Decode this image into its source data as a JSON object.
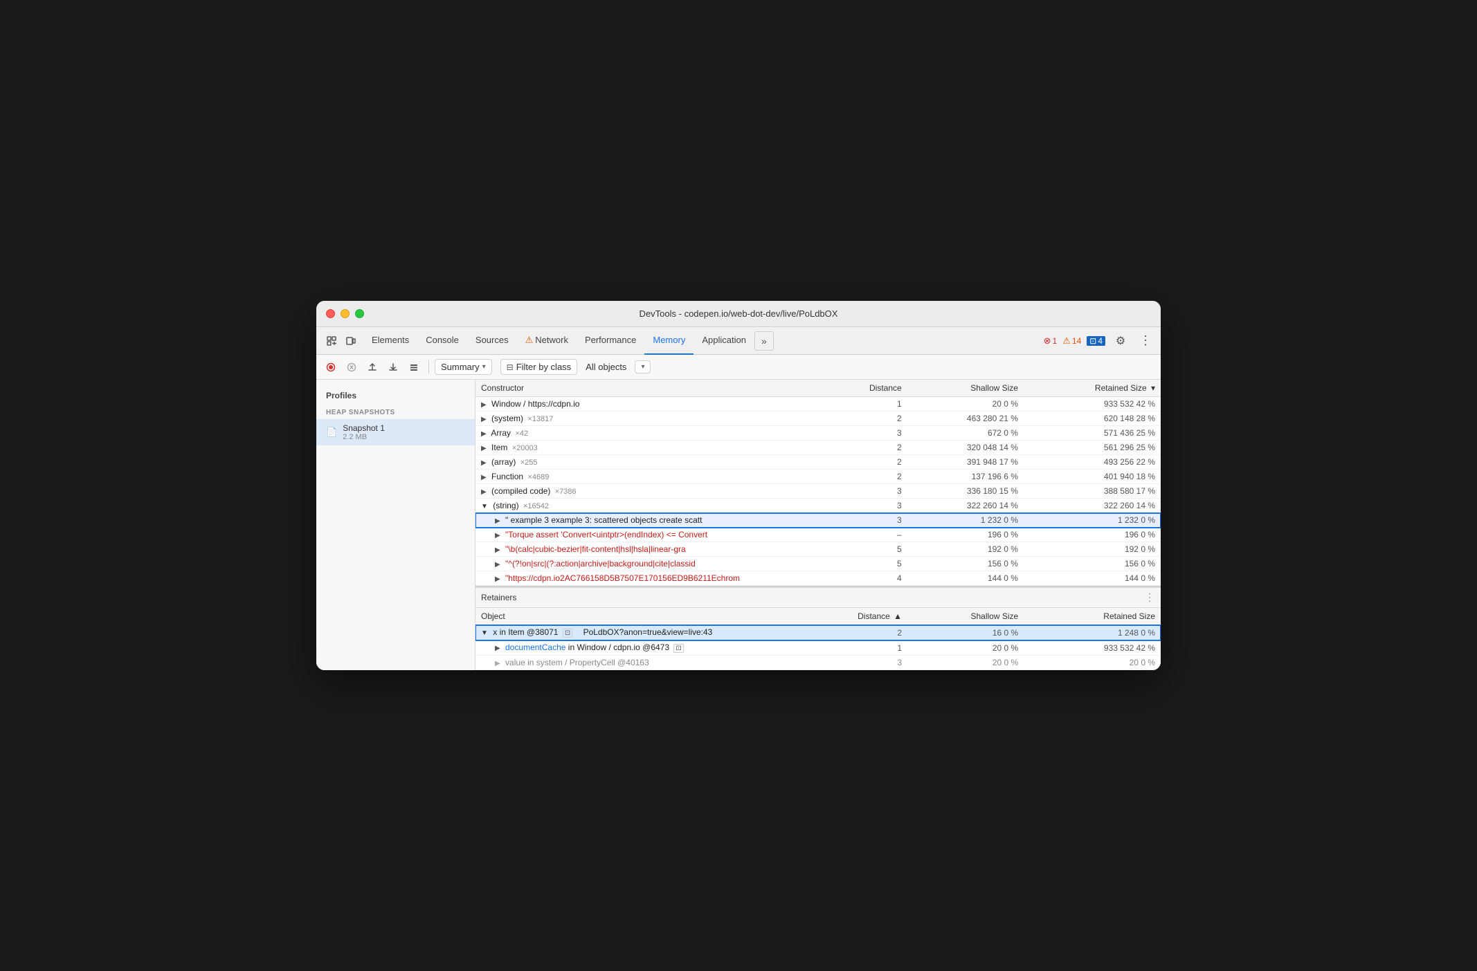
{
  "window": {
    "title": "DevTools - codepen.io/web-dot-dev/live/PoLdbOX"
  },
  "nav": {
    "tabs": [
      {
        "label": "Elements",
        "active": false
      },
      {
        "label": "Console",
        "active": false
      },
      {
        "label": "Sources",
        "active": false
      },
      {
        "label": "Network",
        "active": false,
        "warn": true
      },
      {
        "label": "Performance",
        "active": false
      },
      {
        "label": "Memory",
        "active": true
      },
      {
        "label": "Application",
        "active": false
      }
    ],
    "more_label": "»",
    "err_count": "1",
    "warn_count": "14",
    "info_count": "4"
  },
  "toolbar": {
    "summary_label": "Summary",
    "filter_label": "Filter by class",
    "objects_label": "All objects"
  },
  "sidebar": {
    "title": "Profiles",
    "section_title": "HEAP SNAPSHOTS",
    "snapshot_label": "Snapshot 1",
    "snapshot_size": "2.2 MB"
  },
  "table": {
    "headers": {
      "constructor": "Constructor",
      "distance": "Distance",
      "shallow_size": "Shallow Size",
      "retained_size": "Retained Size"
    },
    "rows": [
      {
        "indent": 0,
        "expanded": false,
        "constructor": "Window / https://cdpn.io",
        "distance": "1",
        "shallow": "20",
        "shallow_pct": "0 %",
        "retained": "933 532",
        "retained_pct": "42 %"
      },
      {
        "indent": 0,
        "expanded": false,
        "constructor": "(system)",
        "count": "×13817",
        "distance": "2",
        "shallow": "463 280",
        "shallow_pct": "21 %",
        "retained": "620 148",
        "retained_pct": "28 %"
      },
      {
        "indent": 0,
        "expanded": false,
        "constructor": "Array",
        "count": "×42",
        "distance": "3",
        "shallow": "672",
        "shallow_pct": "0 %",
        "retained": "571 436",
        "retained_pct": "25 %"
      },
      {
        "indent": 0,
        "expanded": false,
        "constructor": "Item",
        "count": "×20003",
        "distance": "2",
        "shallow": "320 048",
        "shallow_pct": "14 %",
        "retained": "561 296",
        "retained_pct": "25 %"
      },
      {
        "indent": 0,
        "expanded": false,
        "constructor": "(array)",
        "count": "×255",
        "distance": "2",
        "shallow": "391 948",
        "shallow_pct": "17 %",
        "retained": "493 256",
        "retained_pct": "22 %"
      },
      {
        "indent": 0,
        "expanded": false,
        "constructor": "Function",
        "count": "×4689",
        "distance": "2",
        "shallow": "137 196",
        "shallow_pct": "6 %",
        "retained": "401 940",
        "retained_pct": "18 %"
      },
      {
        "indent": 0,
        "expanded": false,
        "constructor": "(compiled code)",
        "count": "×7386",
        "distance": "3",
        "shallow": "336 180",
        "shallow_pct": "15 %",
        "retained": "388 580",
        "retained_pct": "17 %"
      },
      {
        "indent": 0,
        "expanded": true,
        "constructor": "(string)",
        "count": "×16542",
        "distance": "3",
        "shallow": "322 260",
        "shallow_pct": "14 %",
        "retained": "322 260",
        "retained_pct": "14 %"
      },
      {
        "indent": 1,
        "expanded": false,
        "highlighted": true,
        "constructor": "\" example 3 example 3: scattered objects create scatt",
        "distance": "3",
        "shallow": "1 232",
        "shallow_pct": "0 %",
        "retained": "1 232",
        "retained_pct": "0 %"
      },
      {
        "indent": 1,
        "expanded": false,
        "constructor": "\"Torque assert 'Convert<uintptr>(endIndex) <= Convert",
        "distance": "–",
        "shallow": "196",
        "shallow_pct": "0 %",
        "retained": "196",
        "retained_pct": "0 %",
        "str": true
      },
      {
        "indent": 1,
        "expanded": false,
        "constructor": "\"\\b(calc|cubic-bezier|fit-content|hsl|hsla|linear-gra",
        "distance": "5",
        "shallow": "192",
        "shallow_pct": "0 %",
        "retained": "192",
        "retained_pct": "0 %",
        "str": true
      },
      {
        "indent": 1,
        "expanded": false,
        "constructor": "\"^(?!on|src|(?:action|archive|background|cite|classid",
        "distance": "5",
        "shallow": "156",
        "shallow_pct": "0 %",
        "retained": "156",
        "retained_pct": "0 %",
        "str": true
      },
      {
        "indent": 1,
        "expanded": false,
        "constructor": "\"https://cdpn.io2AC766158D5B7507E170156ED9B6211Echrom",
        "distance": "4",
        "shallow": "144",
        "shallow_pct": "0 %",
        "retained": "144",
        "retained_pct": "0 %",
        "str": true
      }
    ]
  },
  "retainers": {
    "header": "Retainers",
    "table_headers": {
      "object": "Object",
      "distance": "Distance",
      "shallow_size": "Shallow Size",
      "retained_size": "Retained Size"
    },
    "rows": [
      {
        "indent": 0,
        "expanded": true,
        "selected": true,
        "object": "x in Item @38071",
        "window_tag": "⊡",
        "link": "PoLdbOX?anon=true&view=live:43",
        "distance": "2",
        "shallow": "16",
        "shallow_pct": "0 %",
        "retained": "1 248",
        "retained_pct": "0 %"
      },
      {
        "indent": 1,
        "expanded": false,
        "object": "documentCache in Window / cdpn.io @6473",
        "window_tag": "⊡",
        "distance": "1",
        "shallow": "20",
        "shallow_pct": "0 %",
        "retained": "933 532",
        "retained_pct": "42 %"
      },
      {
        "indent": 1,
        "expanded": false,
        "object": "value in system / PropertyCell @40163",
        "distance": "3",
        "shallow": "20",
        "shallow_pct": "0 %",
        "retained": "20",
        "retained_pct": "0 %"
      }
    ]
  }
}
